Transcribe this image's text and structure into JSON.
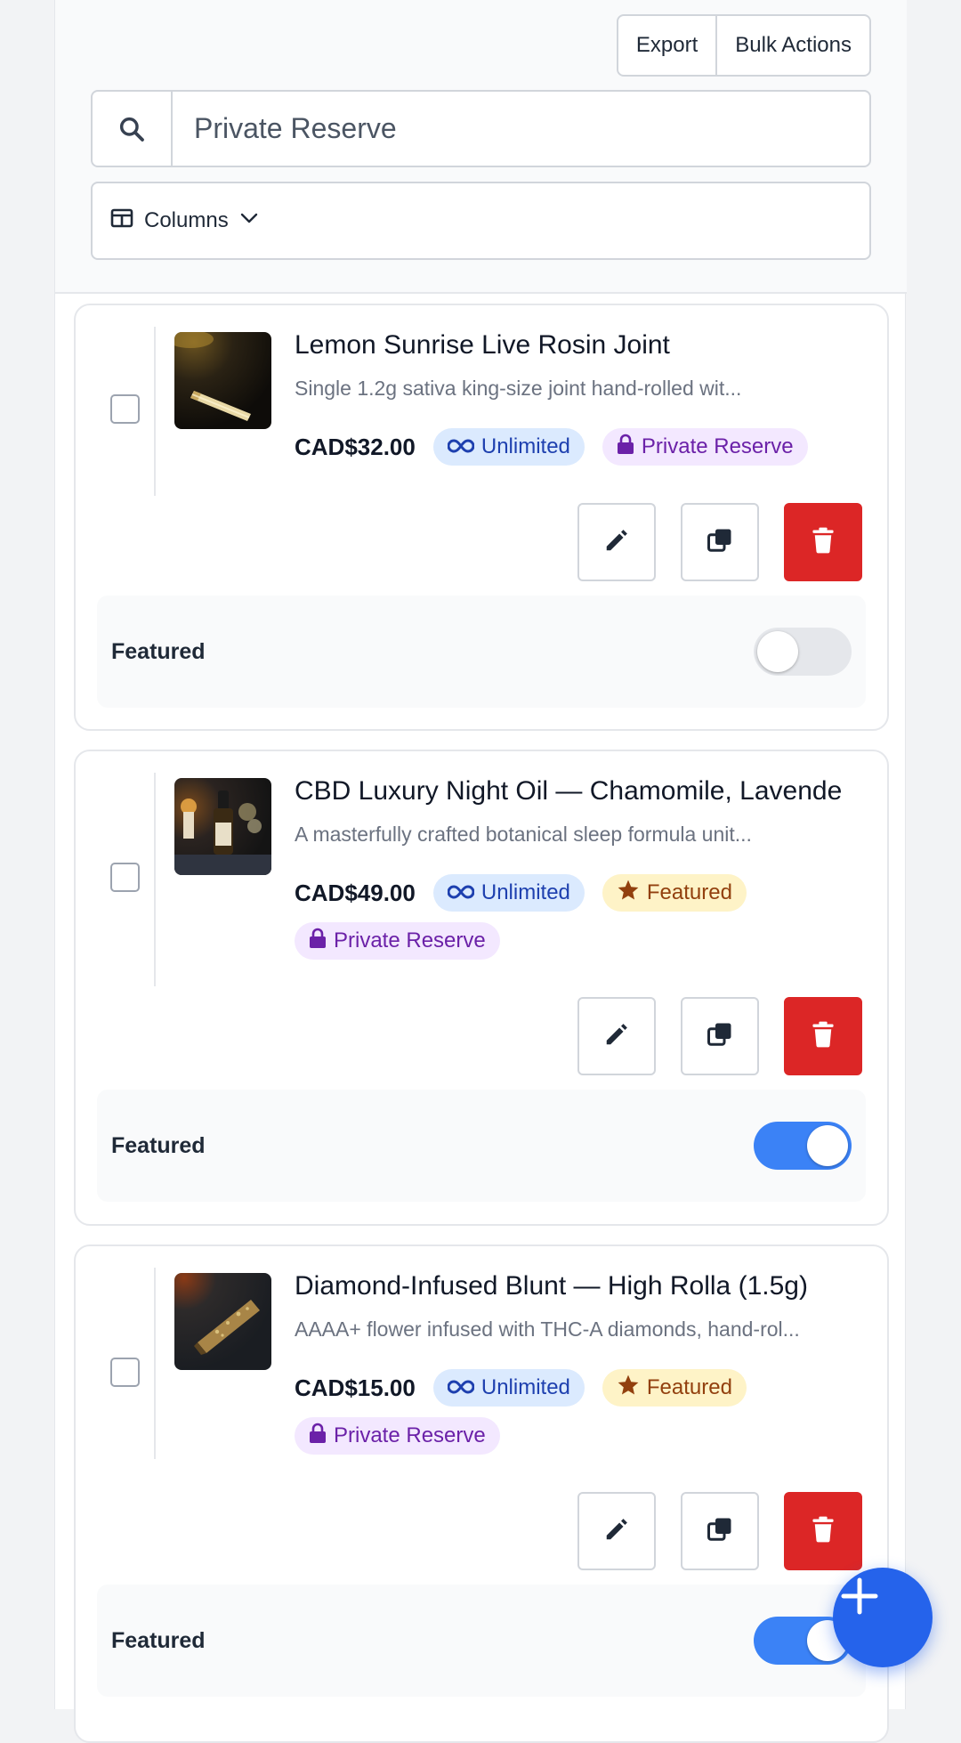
{
  "toolbar": {
    "export_label": "Export",
    "bulk_label": "Bulk Actions",
    "search_value": "Private Reserve",
    "columns_label": "Columns"
  },
  "products": [
    {
      "title": "Lemon Sunrise Live Rosin Joint",
      "description": "Single 1.2g sativa king-size joint hand-rolled wit...",
      "price": "CAD$32.00",
      "badges": {
        "unlimited": "Unlimited",
        "featured": "",
        "private": "Private Reserve"
      },
      "featured_label": "Featured",
      "featured_on": false
    },
    {
      "title": "CBD Luxury Night Oil — Chamomile, Lavende",
      "description": "A masterfully crafted botanical sleep formula unit...",
      "price": "CAD$49.00",
      "badges": {
        "unlimited": "Unlimited",
        "featured": "Featured",
        "private": "Private Reserve"
      },
      "featured_label": "Featured",
      "featured_on": true
    },
    {
      "title": "Diamond-Infused Blunt — High Rolla (1.5g)",
      "description": "AAAA+ flower infused with THC-A diamonds, hand-rol...",
      "price": "CAD$15.00",
      "badges": {
        "unlimited": "Unlimited",
        "featured": "Featured",
        "private": "Private Reserve"
      },
      "featured_label": "Featured",
      "featured_on": true
    }
  ],
  "icons": {
    "search": "search-icon",
    "columns": "columns-icon",
    "edit": "pencil-icon",
    "duplicate": "copy-icon",
    "delete": "trash-icon",
    "unlimited": "infinity-icon",
    "featured": "star-icon",
    "private": "lock-icon",
    "fab": "plus-icon"
  },
  "colors": {
    "accent": "#2563eb",
    "danger": "#dc2626",
    "unlimited_bg": "#dbeafe",
    "featured_bg": "#fef3c7",
    "private_bg": "#f3e8ff"
  }
}
